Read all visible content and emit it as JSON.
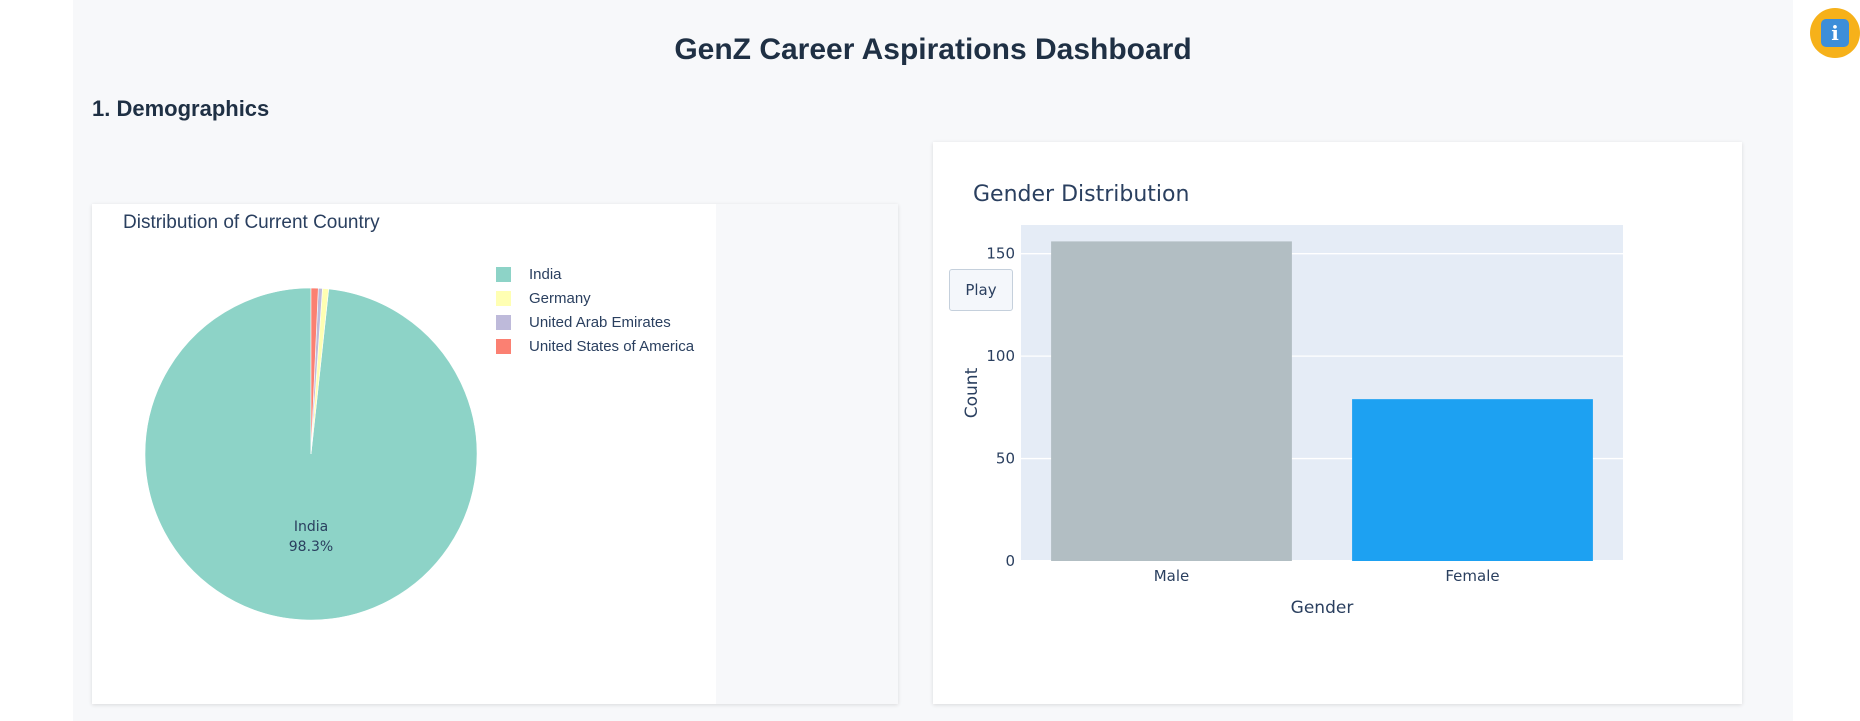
{
  "dashboard": {
    "title": "GenZ Career Aspirations Dashboard",
    "section_title": "1. Demographics"
  },
  "info_button": {
    "icon": "info-icon",
    "glyph": "i"
  },
  "pie_chart": {
    "title": "Distribution of Current Country",
    "inside_label": "India",
    "inside_percent": "98.3%"
  },
  "bar_chart": {
    "title": "Gender Distribution",
    "play_label": "Play"
  },
  "chart_data": [
    {
      "type": "pie",
      "title": "Distribution of Current Country",
      "labels": [
        "India",
        "Germany",
        "United Arab Emirates",
        "United States of America"
      ],
      "values": [
        98.3,
        0.6,
        0.4,
        0.7
      ],
      "colors": [
        "#8dd3c7",
        "#ffffb3",
        "#bebada",
        "#fb8072"
      ],
      "legend_position": "right"
    },
    {
      "type": "bar",
      "title": "Gender Distribution",
      "categories": [
        "Male",
        "Female"
      ],
      "values": [
        156,
        79
      ],
      "colors": [
        "#b2bec3",
        "#1da1f2"
      ],
      "xlabel": "Gender",
      "ylabel": "Count",
      "yticks": [
        0,
        50,
        100,
        150
      ],
      "ylim": [
        0,
        164
      ],
      "grid": true,
      "plot_bg": "#e5ecf6"
    }
  ]
}
